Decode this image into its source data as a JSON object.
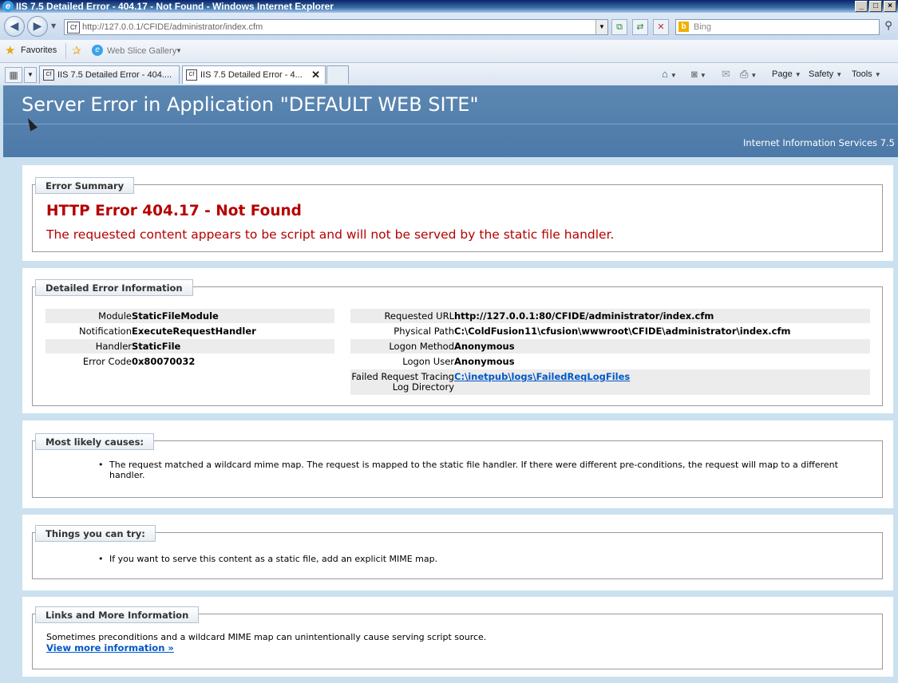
{
  "window": {
    "title": "IIS 7.5 Detailed Error - 404.17 - Not Found - Windows Internet Explorer",
    "buttons": [
      "_",
      "□",
      "×"
    ]
  },
  "address_bar": {
    "back_icon": "back-arrow-icon",
    "forward_icon": "forward-arrow-icon",
    "favicon_text": "Cf",
    "url": "http://127.0.0.1/CFIDE/administrator/index.cfm",
    "search_placeholder": "Bing",
    "bing_logo": "b"
  },
  "favorites_bar": {
    "favorites_label": "Favorites",
    "web_slice_label": "Web Slice Gallery"
  },
  "tabs": [
    {
      "label": "IIS 7.5 Detailed Error - 404....",
      "icon": "Cf",
      "active": false
    },
    {
      "label": "IIS 7.5 Detailed Error - 4...",
      "icon": "Cf",
      "active": true
    }
  ],
  "command_bar": {
    "page_label": "Page",
    "safety_label": "Safety",
    "tools_label": "Tools"
  },
  "page": {
    "heading": "Server Error in Application \"DEFAULT WEB SITE\"",
    "server_label": "Internet Information Services 7.5",
    "error_summary": {
      "legend": "Error Summary",
      "title": "HTTP Error 404.17 - Not Found",
      "message": "The requested content appears to be script and will not be served by the static file handler."
    },
    "detailed": {
      "legend": "Detailed Error Information",
      "left": [
        {
          "label": "Module",
          "value": "StaticFileModule"
        },
        {
          "label": "Notification",
          "value": "ExecuteRequestHandler"
        },
        {
          "label": "Handler",
          "value": "StaticFile"
        },
        {
          "label": "Error Code",
          "value": "0x80070032"
        }
      ],
      "right": [
        {
          "label": "Requested URL",
          "value": "http://127.0.0.1:80/CFIDE/administrator/index.cfm"
        },
        {
          "label": "Physical Path",
          "value": "C:\\ColdFusion11\\cfusion\\wwwroot\\CFIDE\\administrator\\index.cfm"
        },
        {
          "label": "Logon Method",
          "value": "Anonymous"
        },
        {
          "label": "Logon User",
          "value": "Anonymous"
        }
      ],
      "tracing_label_line1": "Failed Request Tracing",
      "tracing_label_line2": "Log Directory",
      "tracing_value": "C:\\inetpub\\logs\\FailedReqLogFiles"
    },
    "causes": {
      "legend": "Most likely causes:",
      "items": [
        "The request matched a wildcard mime map. The request is mapped to the static file handler. If there were different pre-conditions, the request will map to a different handler."
      ]
    },
    "try": {
      "legend": "Things you can try:",
      "items": [
        "If you want to serve this content as a static file, add an explicit MIME map."
      ]
    },
    "links": {
      "legend": "Links and More Information",
      "text": "Sometimes preconditions and a wildcard MIME map can unintentionally cause serving script source.",
      "more_link": "View more information »"
    }
  }
}
